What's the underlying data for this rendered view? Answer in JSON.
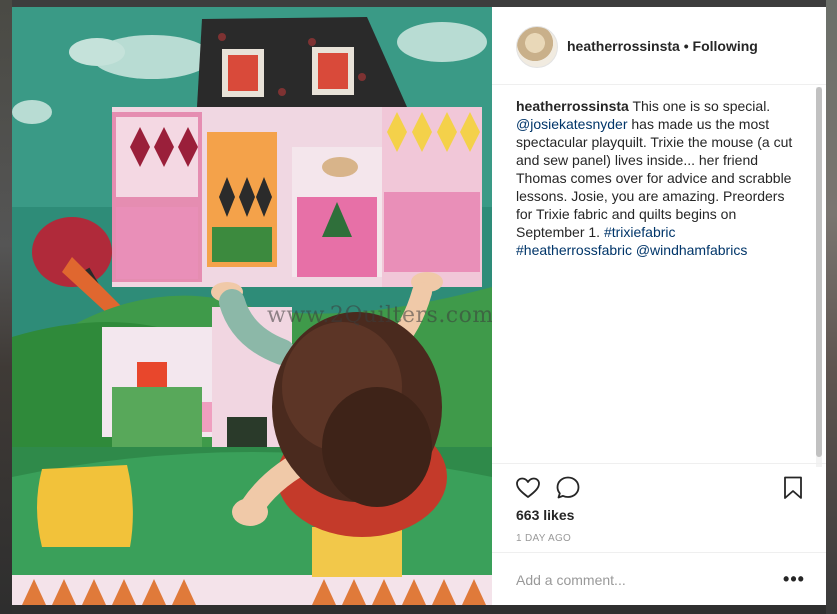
{
  "post": {
    "username": "heatherrossinsta",
    "separator": "•",
    "follow_status": "Following",
    "caption": {
      "username": "heatherrossinsta",
      "t1": " This one is so special. ",
      "mention1": "@josiekatesnyder",
      "t2": " has made us the most spectacular playquilt. Trixie the mouse (a cut and sew panel) lives inside... her friend Thomas comes over for advice and scrabble lessons. Josie, you are amazing. Preorders for Trixie fabric and quilts begins on September 1. ",
      "tag1": "#trixiefabric",
      "tag2": "#heatherrossfabric",
      "mention2": "@windhamfabrics"
    },
    "likes": "663 likes",
    "timestamp": "1 DAY AGO",
    "comment_placeholder": "Add a comment...",
    "more_label": "•••"
  },
  "photo": {
    "watermark": "www.2Quilters.com"
  },
  "icons": {
    "like": "heart-icon",
    "comment": "comment-bubble-icon",
    "save": "bookmark-icon",
    "more": "more-options-icon"
  },
  "colors": {
    "text": "#262626",
    "link": "#003569",
    "muted": "#999999",
    "border": "#efefef"
  }
}
